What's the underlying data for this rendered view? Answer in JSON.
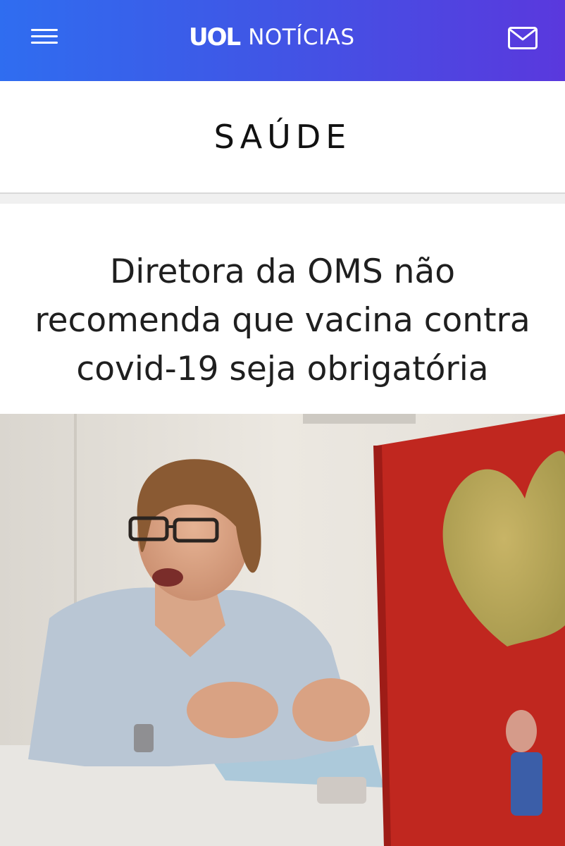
{
  "header": {
    "logo": "UOL",
    "section": "NOTÍCIAS",
    "menu_icon": "hamburger-menu-icon",
    "mail_icon": "mail-envelope-icon",
    "colors": {
      "gradient_start": "#2f6df0",
      "gradient_end": "#5a38dd"
    }
  },
  "category": {
    "title": "SAÚDE"
  },
  "article": {
    "headline": "Diretora da OMS não recomenda que vacina contra covid-19 seja obrigatória"
  }
}
